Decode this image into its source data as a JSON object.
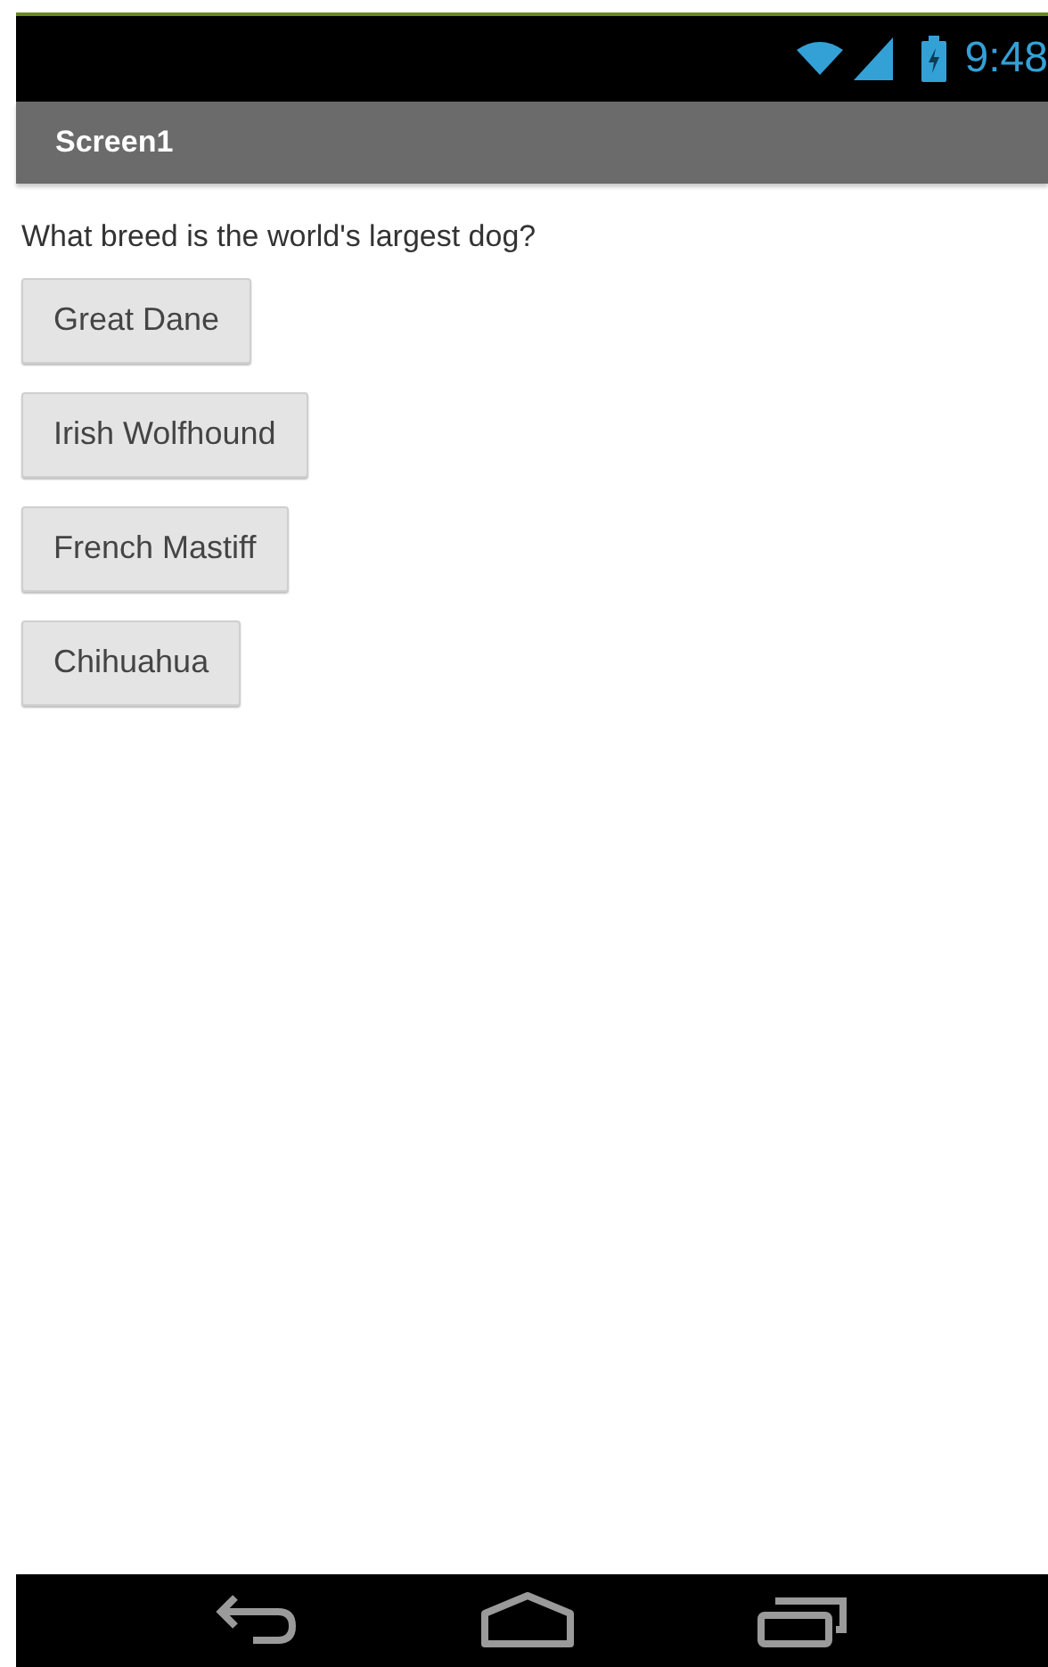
{
  "status_bar": {
    "time": "9:48"
  },
  "title_bar": {
    "title": "Screen1"
  },
  "question": "What breed is the world's largest dog?",
  "options": [
    "Great Dane",
    "Irish Wolfhound",
    "French Mastiff",
    "Chihuahua"
  ]
}
